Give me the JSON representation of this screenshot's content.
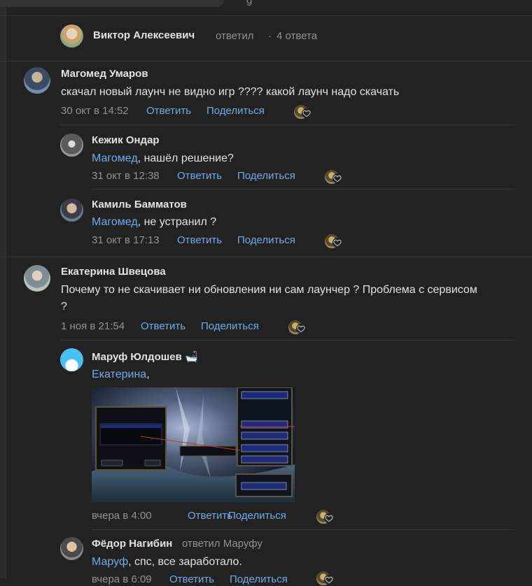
{
  "top": {
    "hint": "g"
  },
  "thread_header": {
    "author": "Виктор Алексеевич",
    "replied": "ответил",
    "dot": "·",
    "count": "4 ответа"
  },
  "labels": {
    "reply": "Ответить",
    "share": "Поделиться"
  },
  "comments": [
    {
      "author": "Магомед Умаров",
      "text": "скачал новый лаунч не видно игр ???? какой лаунч надо скачать",
      "time": "30 окт в 14:52"
    },
    {
      "author": "Кежик Ондар",
      "mention": "Магомед",
      "text": ", нашёл решение?",
      "time": "31 окт в 12:38"
    },
    {
      "author": "Камиль Бамматов",
      "mention": "Магомед",
      "text": ", не устранил ?",
      "time": "31 окт в 17:13"
    },
    {
      "author": "Екатерина Швецова",
      "text": "Почему то не скачивает ни обновления ни сам лаунчер ? Проблема с сервисом ?",
      "time": "1 ноя в 21:54"
    },
    {
      "author": "Маруф Юлдошев",
      "emoji": "🛁",
      "mention": "Екатерина",
      "text": ",",
      "time": "вчера в 4:00"
    },
    {
      "author": "Фёдор Нагибин",
      "replied": "ответил Маруфу",
      "mention": "Маруф",
      "text": ", спс, все заработало.",
      "time": "вчера в 6:09"
    }
  ],
  "colors": {
    "background": "#222222",
    "link": "#71aaeb",
    "muted": "#939393",
    "text": "#e1e3e6"
  }
}
